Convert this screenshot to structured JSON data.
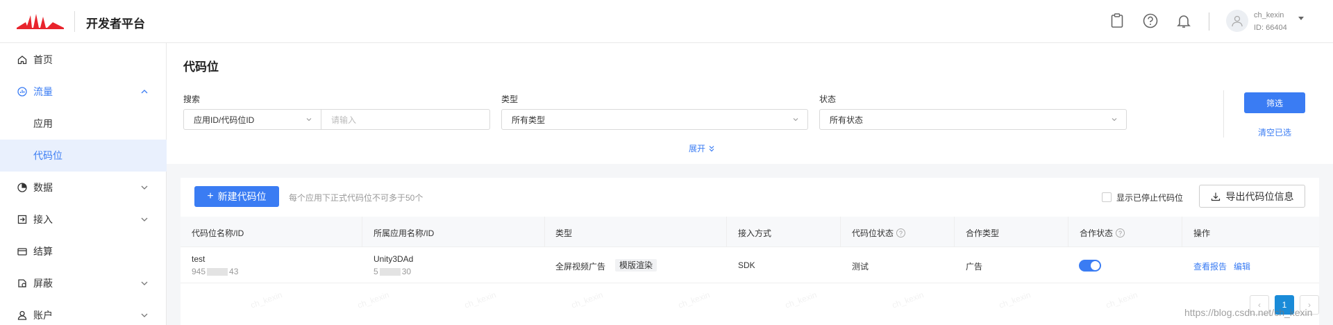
{
  "header": {
    "brand": "开发者平台",
    "user_name": "ch_kexin",
    "user_id": "ID: 66404"
  },
  "sidebar": {
    "items": [
      {
        "label": "首页",
        "icon": "home-icon"
      },
      {
        "label": "流量",
        "icon": "traffic-icon"
      },
      {
        "label": "应用"
      },
      {
        "label": "代码位"
      },
      {
        "label": "数据",
        "icon": "pie-chart-icon"
      },
      {
        "label": "接入",
        "icon": "import-icon"
      },
      {
        "label": "结算",
        "icon": "wallet-icon"
      },
      {
        "label": "屏蔽",
        "icon": "block-icon"
      },
      {
        "label": "账户",
        "icon": "user-icon"
      }
    ]
  },
  "page": {
    "title": "代码位"
  },
  "filters": {
    "search_label": "搜索",
    "search_select": "应用ID/代码位ID",
    "search_placeholder": "请输入",
    "type_label": "类型",
    "type_value": "所有类型",
    "status_label": "状态",
    "status_value": "所有状态",
    "expand": "展开",
    "filter_button": "筛选",
    "clear_link": "清空已选"
  },
  "toolbar": {
    "new_button": "新建代码位",
    "hint": "每个应用下正式代码位不可多于50个",
    "show_stopped": "显示已停止代码位",
    "export_button": "导出代码位信息"
  },
  "table": {
    "headers": [
      "代码位名称/ID",
      "所属应用名称/ID",
      "类型",
      "接入方式",
      "代码位状态",
      "合作类型",
      "合作状态",
      "操作"
    ],
    "rows": [
      {
        "name": "test",
        "id": "945",
        "id_end": "43",
        "app_name": "Unity3DAd",
        "app_id": "5",
        "app_id_end": "30",
        "type": "全屏视频广告",
        "tag": "模版渲染",
        "access": "SDK",
        "status": "测试",
        "coop_type": "广告",
        "coop_on": true,
        "op_report": "查看报告",
        "op_edit": "编辑"
      }
    ]
  },
  "pagination": {
    "current": "1"
  },
  "watermark": {
    "text": "ch_kexin",
    "csdn": "https://blog.csdn.net/ch_kexin"
  },
  "colors": {
    "accent": "#3a7cf3",
    "logo_red": "#e8242c"
  }
}
